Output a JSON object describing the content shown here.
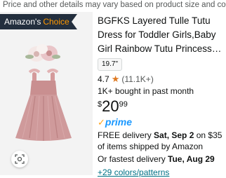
{
  "disclaimer": "Price and other details may vary based on product size and color.",
  "badge": {
    "brand": "Amazon's",
    "label": "Choice"
  },
  "product": {
    "title": "BGFKS Layered Tulle Tutu Dress for Toddler Girls,Baby Girl Rainbow Tutu Princess Skirt Se...",
    "size_option": "19.7\"",
    "rating": "4.7",
    "rating_count": "(11.1K+)",
    "bought": "1K+ bought in past month",
    "price": {
      "symbol": "$",
      "whole": "20",
      "fraction": "99"
    },
    "prime": {
      "check": "✓",
      "word": "prime"
    },
    "delivery": {
      "prefix": "FREE delivery ",
      "date": "Sat, Sep 2",
      "suffix": " on $35 of items shipped by Amazon"
    },
    "fastest": {
      "prefix": "Or fastest delivery ",
      "date": "Tue, Aug 29"
    },
    "colors_link": "+29 colors/patterns"
  },
  "colors": {
    "badge_bg": "#232f3e",
    "badge_accent": "#ff9900",
    "star": "#de7921",
    "prime_blue": "#1a98ff",
    "link": "#007185",
    "dress": "#c98f90"
  },
  "icons": {
    "star": "star-icon",
    "lens": "visual-search-icon",
    "prime_check": "prime-check-icon"
  }
}
